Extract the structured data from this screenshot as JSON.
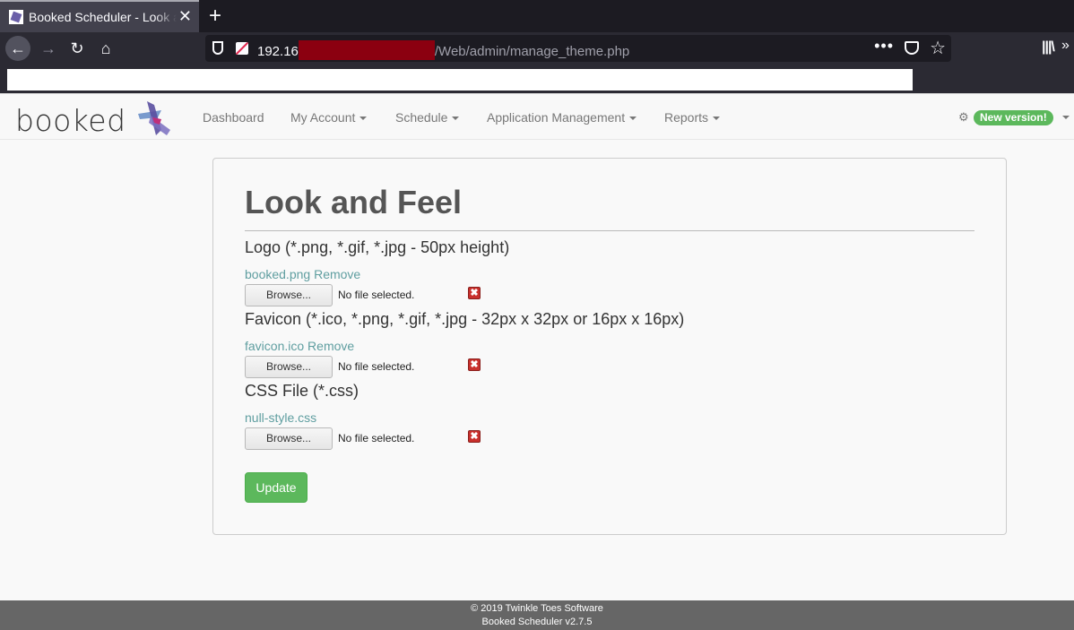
{
  "browser": {
    "tab_title": "Booked Scheduler - Look and Feel",
    "tab_close": "✕",
    "new_tab": "+",
    "url_host_visible": "192.16",
    "url_path": "/Web/admin/manage_theme.php",
    "icons": {
      "back": "←",
      "forward": "→",
      "reload": "↻",
      "home": "⌂",
      "page_actions": "•••",
      "bookmark_star": "☆",
      "library": "|||\\",
      "overflow": "»"
    }
  },
  "app": {
    "logo_text": "booked",
    "nav": {
      "dashboard": "Dashboard",
      "my_account": "My Account",
      "schedule": "Schedule",
      "application_management": "Application Management",
      "reports": "Reports"
    },
    "gear_icon": "⚙",
    "new_version_badge": "New version!"
  },
  "page": {
    "title": "Look and Feel",
    "logo_section": {
      "label": "Logo (*.png, *.gif, *.jpg - 50px height)",
      "file_link": "booked.png",
      "remove_link": "Remove",
      "browse": "Browse...",
      "no_file": "No file selected."
    },
    "favicon_section": {
      "label": "Favicon (*.ico, *.png, *.gif, *.jpg - 32px x 32px or 16px x 16px)",
      "file_link": "favicon.ico",
      "remove_link": "Remove",
      "browse": "Browse...",
      "no_file": "No file selected."
    },
    "css_section": {
      "label": "CSS File (*.css)",
      "file_link": "null-style.css",
      "browse": "Browse...",
      "no_file": "No file selected."
    },
    "remove_icon": "✖",
    "update_button": "Update"
  },
  "footer": {
    "copyright": "© 2019 Twinkle Toes Software",
    "version": "Booked Scheduler v2.7.5"
  },
  "colors": {
    "brand_green": "#5cb85c",
    "link_teal": "#5f9ea0",
    "remove_red": "#c9302c",
    "url_redaction": "#8b0010"
  }
}
